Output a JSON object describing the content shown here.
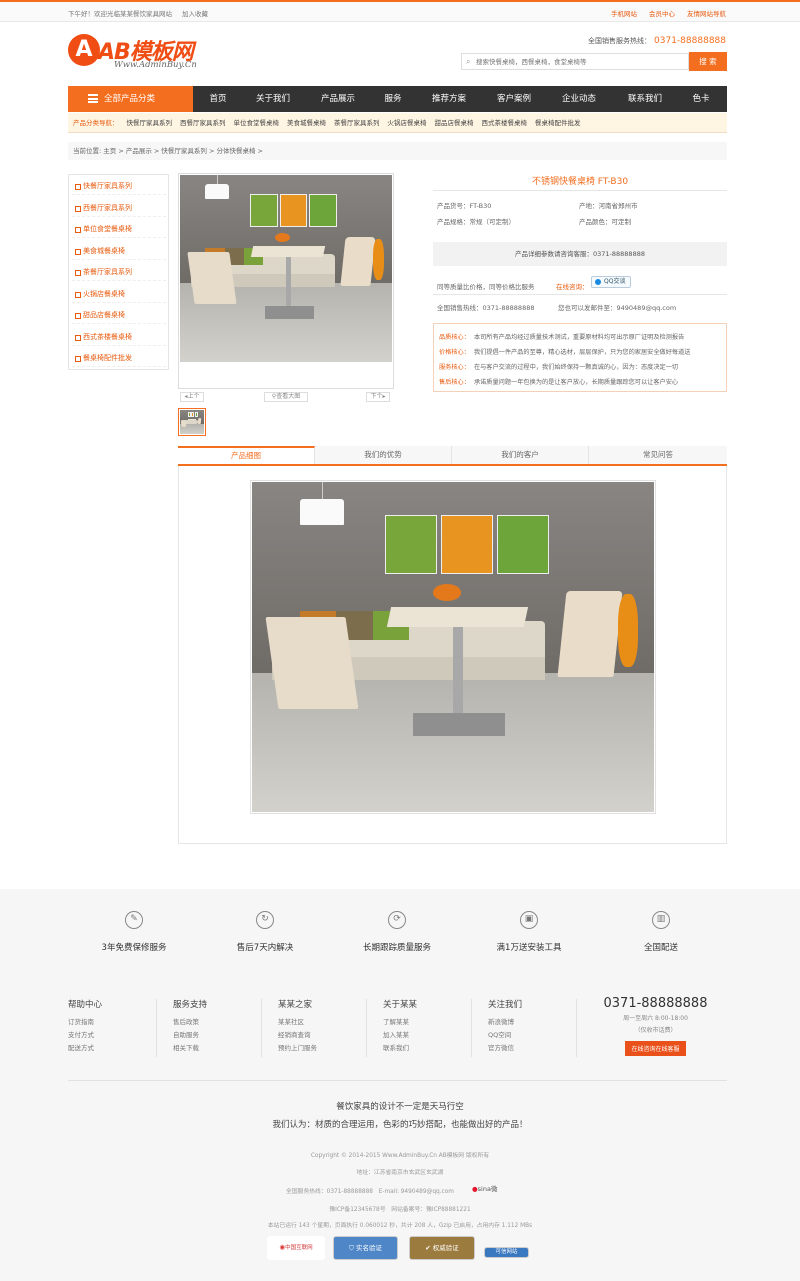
{
  "topbar": {
    "welcome": "下午好！欢迎光临某某餐饮家具网站",
    "favorite": "加入收藏",
    "mobile": "手机网站",
    "member": "会员中心",
    "links": "友情网站导航"
  },
  "header": {
    "logo_mark": "A",
    "logo_text": "AB模板网",
    "logo_sub": "Www.AdminBuy.Cn",
    "hotline_label": "全国销售服务热线：",
    "hotline_number": "0371-88888888",
    "search_placeholder": "搜索快餐桌椅，西餐桌椅，食堂桌椅等",
    "search_button": "搜 索"
  },
  "nav": {
    "all_categories": "全部产品分类",
    "items": [
      "首页",
      "关于我们",
      "产品展示",
      "服务",
      "推荐方案",
      "客户案例",
      "企业动态",
      "联系我们",
      "色卡"
    ]
  },
  "category_bar": {
    "label": "产品分类导航：",
    "items": [
      "快餐厅家具系列",
      "西餐厅家具系列",
      "单位食堂餐桌椅",
      "美食城餐桌椅",
      "茶餐厅家具系列",
      "火锅店餐桌椅",
      "甜品店餐桌椅",
      "西式茶楼餐桌椅",
      "餐桌椅配件批发"
    ]
  },
  "breadcrumb": "当前位置: 主页 > 产品展示 > 快餐厅家具系列 > 分体快餐桌椅 >",
  "sidebar": {
    "items": [
      "快餐厅家具系列",
      "西餐厅家具系列",
      "单位食堂餐桌椅",
      "美食城餐桌椅",
      "茶餐厅家具系列",
      "火锅店餐桌椅",
      "甜品店餐桌椅",
      "西式茶楼餐桌椅",
      "餐桌椅配件批发"
    ]
  },
  "gallery": {
    "prev": "上个",
    "view_large": "查看大图",
    "next": "下个"
  },
  "product": {
    "title": "不锈钢快餐桌椅 FT-B30",
    "model_label": "产品货号：FT-B30",
    "origin_label": "产地：河南省郑州市",
    "spec_label": "产品规格：常规（可定制）",
    "color_label": "产品颜色：可定制",
    "ask": "产品详细参数请咨询客服：0371-88888888",
    "promo": "同等质量比价格，同等价格比服务",
    "online": "在线咨询：",
    "qq": "QQ交谈",
    "hotline": "全国销售热线：0371-88888888",
    "email": "您也可以发邮件至：9490489@qq.com"
  },
  "commitments": [
    {
      "label": "品质核心：",
      "text": "本司所有产品均经过质量技术测试，重要原材料均可出示原厂证明及检测报告"
    },
    {
      "label": "价格核心：",
      "text": "我们提倡一件产品的至尊，精心选材，层层保护，只为您的家居安全做好每道送"
    },
    {
      "label": "服务核心：",
      "text": "在与客户交流的过程中，我们始终保持一颗真诚的心，因为：态度决定一切"
    },
    {
      "label": "售后核心：",
      "text": "承诺质量问题一年包换为的是让客户放心，长期质量跟踪您可以让客户安心"
    }
  ],
  "tabs": [
    "产品细图",
    "我们的优势",
    "我们的客户",
    "常见问答"
  ],
  "services": [
    {
      "icon": "wrench-icon",
      "glyph": "✎",
      "title": "3年免费保修服务"
    },
    {
      "icon": "clock-icon",
      "glyph": "↻",
      "title": "售后7天内解决"
    },
    {
      "icon": "refresh-icon",
      "glyph": "⟳",
      "title": "长期跟踪质量服务"
    },
    {
      "icon": "gift-icon",
      "glyph": "▣",
      "title": "满1万送安装工具"
    },
    {
      "icon": "map-icon",
      "glyph": "▥",
      "title": "全国配送"
    }
  ],
  "footer_cols": [
    {
      "title": "帮助中心",
      "items": [
        "订货指南",
        "支付方式",
        "配送方式"
      ]
    },
    {
      "title": "服务支持",
      "items": [
        "售后政策",
        "自助服务",
        "相关下载"
      ]
    },
    {
      "title": "某某之家",
      "items": [
        "某某社区",
        "经销商查询",
        "预约上门服务"
      ]
    },
    {
      "title": "关于某某",
      "items": [
        "了解某某",
        "加入某某",
        "联系我们"
      ]
    },
    {
      "title": "关注我们",
      "items": [
        "新浪微博",
        "QQ空间",
        "官方微信"
      ]
    }
  ],
  "footer_contact": {
    "phone": "0371-88888888",
    "hours": "周一至周六 8:00-18:00",
    "note": "（仅收市话费）",
    "button": "在线咨询在线客服"
  },
  "slogan": {
    "line1": "餐饮家具的设计不一定是天马行空",
    "line2": "我们认为：材质的合理运用，色彩的巧妙搭配，也能做出好的产品！"
  },
  "copyright": [
    "Copyright © 2014-2015 Www.AdminBuy.Cn AB模板网 版权所有",
    "地址：江苏省南京市玄武区玄武湖",
    "全国服务热线：0371-88888888　E-mail: 9490489@qq.com",
    "豫ICP备12345678号　网站备案号：豫ICP88881221",
    "本站已运行 143 个星期，页面执行 0.060012 秒，共计 208 人，Gzip 已启用，占用内存 1.112 MBs"
  ],
  "sina": "sina微",
  "badges": [
    "中国互联网",
    "实名验证",
    "权威验证",
    "可信网站"
  ],
  "colors": {
    "accent": "#f46e1f",
    "nav_dark": "#333333"
  }
}
